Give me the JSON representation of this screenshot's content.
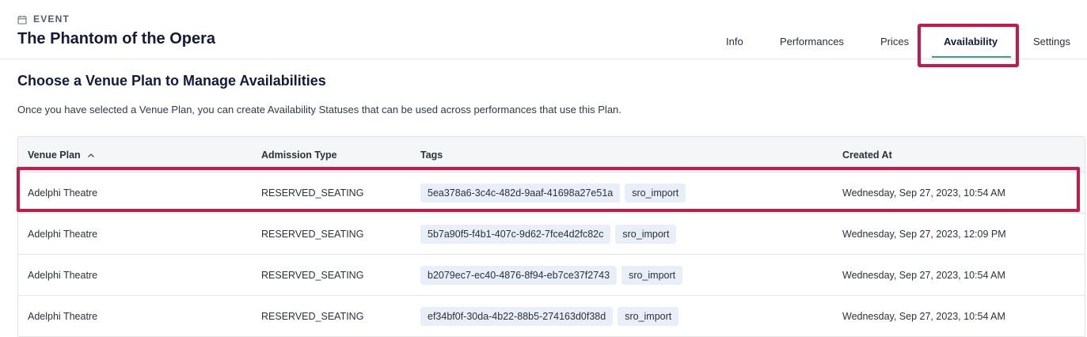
{
  "header": {
    "eyebrow": "EVENT",
    "title": "The Phantom of the Opera",
    "tabs": [
      {
        "label": "Info"
      },
      {
        "label": "Performances"
      },
      {
        "label": "Prices"
      },
      {
        "label": "Availability"
      },
      {
        "label": "Settings"
      }
    ],
    "active_tab": "Availability"
  },
  "main": {
    "heading": "Choose a Venue Plan to Manage Availabilities",
    "description": "Once you have selected a Venue Plan, you can create Availability Statuses that can be used across performances that use this Plan."
  },
  "table": {
    "columns": [
      "Venue Plan",
      "Admission Type",
      "Tags",
      "Created At"
    ],
    "sorted_column": "Venue Plan",
    "sort_direction": "ascending",
    "rows": [
      {
        "venue_plan": "Adelphi Theatre",
        "admission_type": "RESERVED_SEATING",
        "tags": [
          "5ea378a6-3c4c-482d-9aaf-41698a27e51a",
          "sro_import"
        ],
        "created_at": "Wednesday, Sep 27, 2023, 10:54 AM"
      },
      {
        "venue_plan": "Adelphi Theatre",
        "admission_type": "RESERVED_SEATING",
        "tags": [
          "5b7a90f5-f4b1-407c-9d62-7fce4d2fc82c",
          "sro_import"
        ],
        "created_at": "Wednesday, Sep 27, 2023, 12:09 PM"
      },
      {
        "venue_plan": "Adelphi Theatre",
        "admission_type": "RESERVED_SEATING",
        "tags": [
          "b2079ec7-ec40-4876-8f94-eb7ce37f2743",
          "sro_import"
        ],
        "created_at": "Wednesday, Sep 27, 2023, 10:54 AM"
      },
      {
        "venue_plan": "Adelphi Theatre",
        "admission_type": "RESERVED_SEATING",
        "tags": [
          "ef34bf0f-30da-4b22-88b5-274163d0f38d",
          "sro_import"
        ],
        "created_at": "Wednesday, Sep 27, 2023, 10:54 AM"
      }
    ]
  },
  "colors": {
    "highlight": "#c8184a",
    "active_tab_underline": "#3e9c82",
    "title": "#131a3d",
    "tag_bg": "#e8eff8"
  }
}
